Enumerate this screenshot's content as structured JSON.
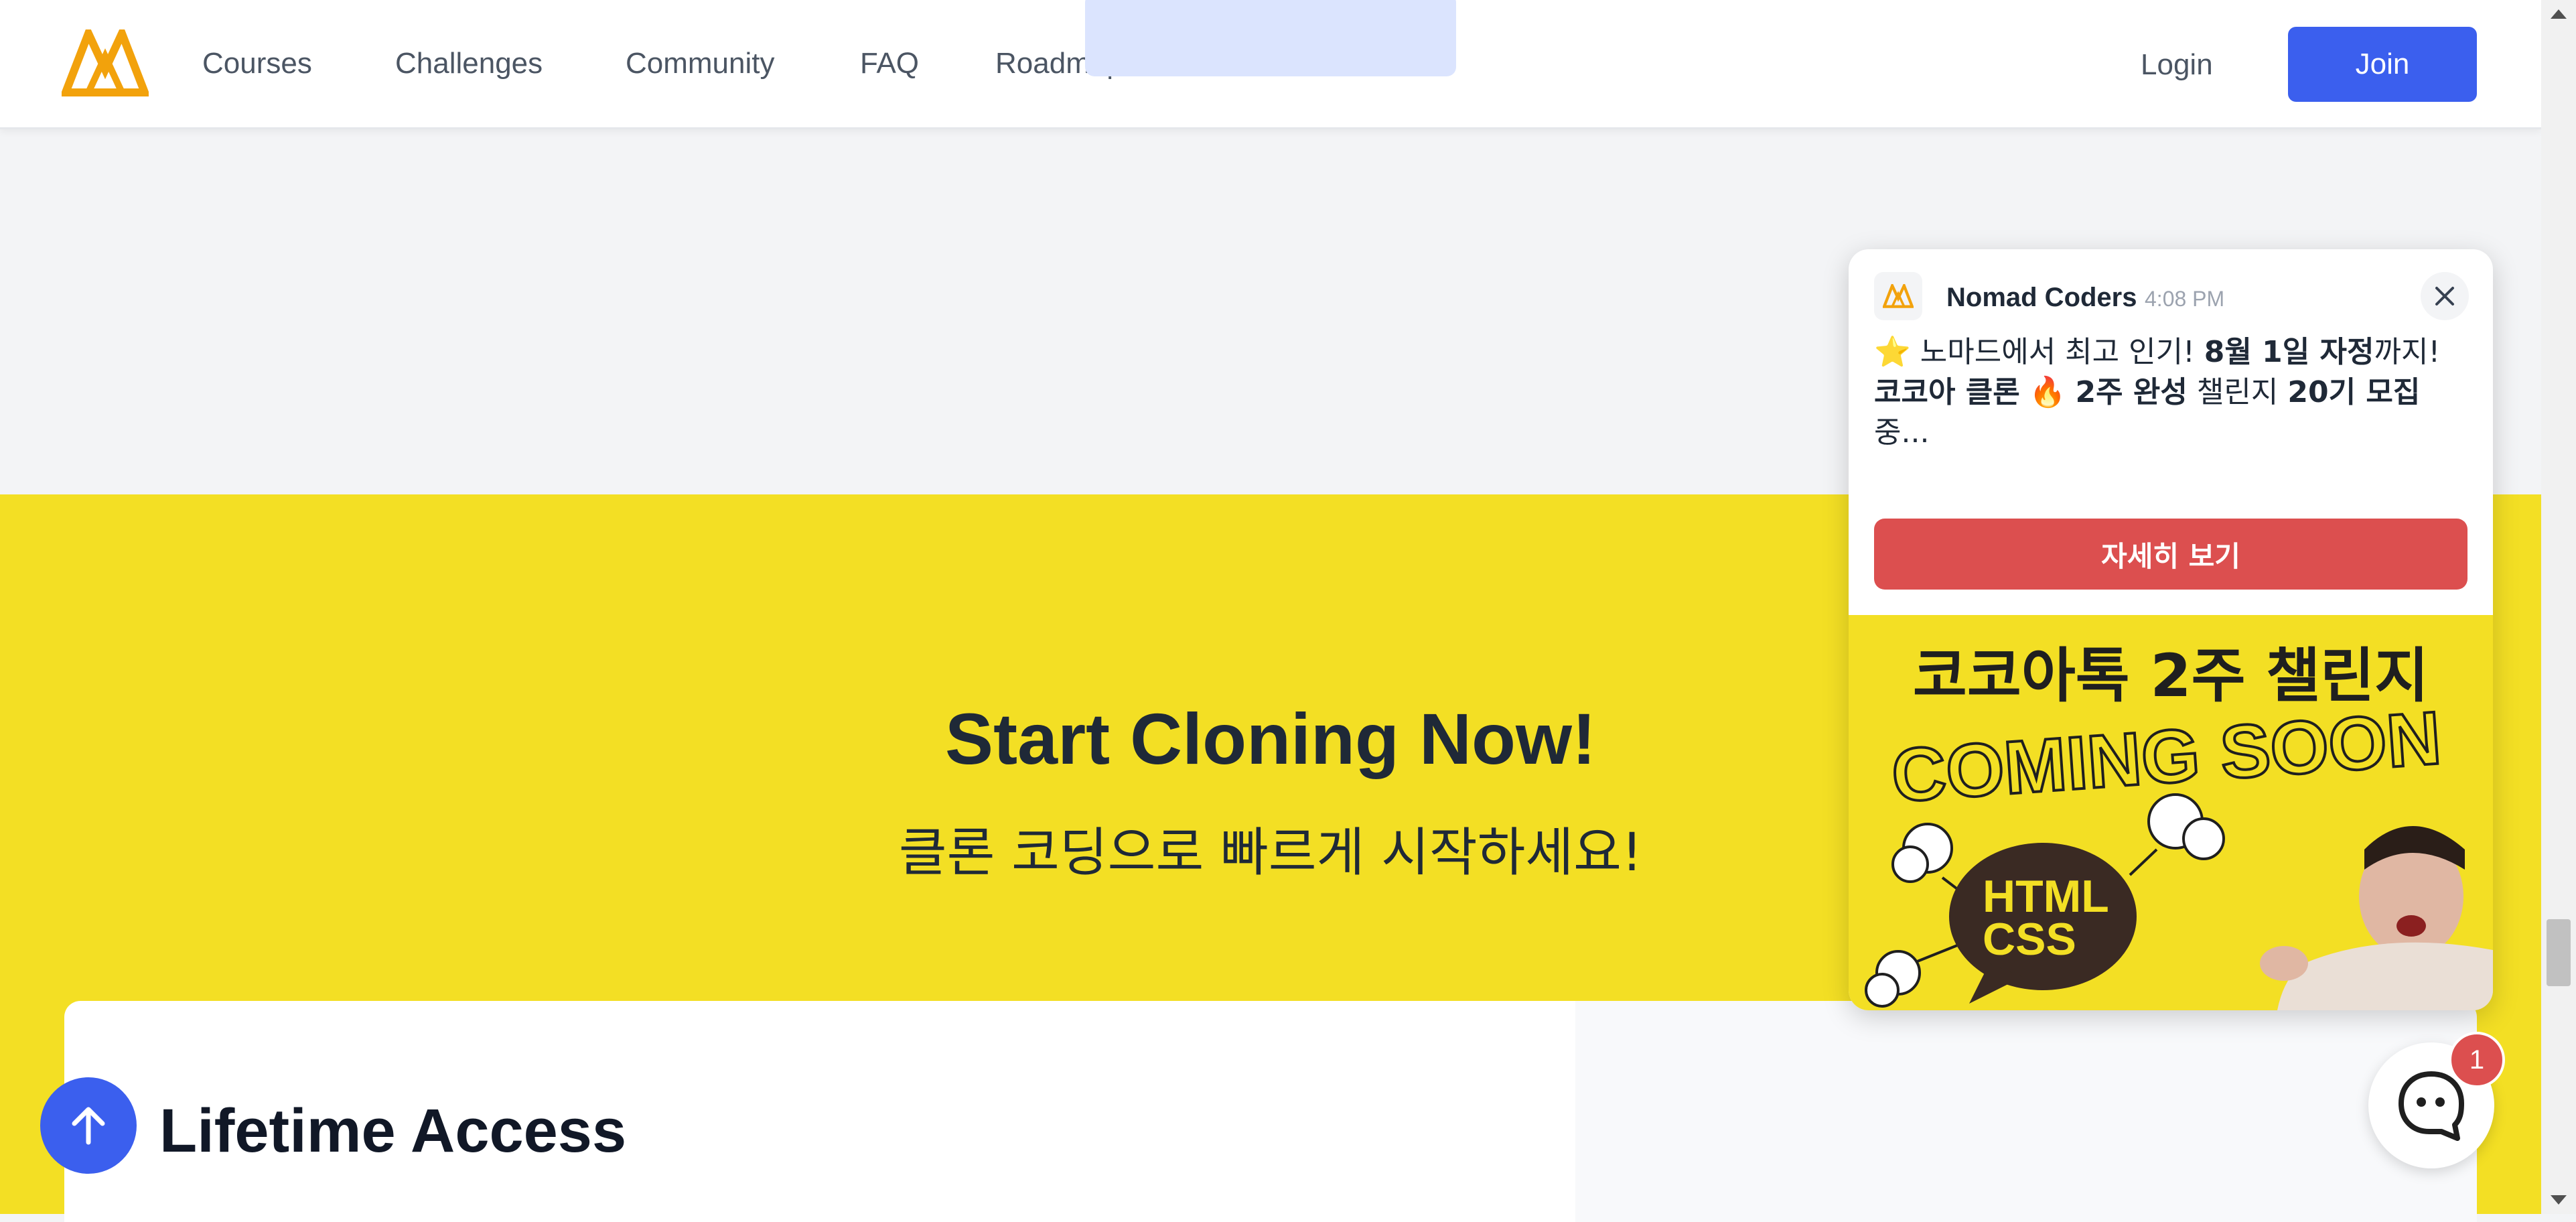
{
  "header": {
    "nav": [
      "Courses",
      "Challenges",
      "Community",
      "FAQ",
      "Roadmap"
    ],
    "login_label": "Login",
    "join_label": "Join",
    "accent": "#3b5fee",
    "logo_color": "#f2a20c"
  },
  "hero": {
    "title": "Start Cloning Now!",
    "subtitle": "클론 코딩으로 빠르게 시작하세요!",
    "background": "#f3df24"
  },
  "section": {
    "heading": "Lifetime Access"
  },
  "popup": {
    "sender": "Nomad Coders",
    "time": "4:08 PM",
    "message_line1_emoji": "⭐",
    "message_line1_text": "노마드에서 최고 인기!",
    "message_line1_bold": "8월 1일 자정",
    "message_line1_tail": "까지!",
    "message_line2_bold1": "코코아 클론",
    "message_line2_emoji": "🔥",
    "message_line2_bold2": "2주 완성",
    "message_line2_mid": "챌린지",
    "message_line2_bold3": "20기 모집",
    "message_line2_tail": "중...",
    "cta_label": "자세히 보기",
    "cta_color": "#dc4f4f",
    "promo_title": "코코아톡 2주 챌린지",
    "promo_banner": "COMING SOON",
    "promo_bubble_line1": "HTML",
    "promo_bubble_line2": "CSS"
  },
  "chat": {
    "badge_count": "1"
  }
}
